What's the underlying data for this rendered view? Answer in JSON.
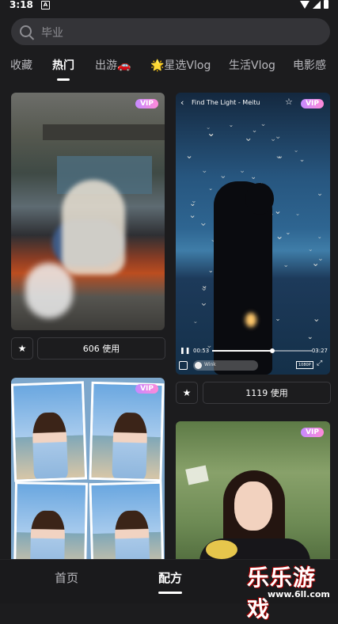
{
  "status_bar": {
    "time": "3:18",
    "notif_icon": "A"
  },
  "search": {
    "placeholder": "毕业"
  },
  "tabs": [
    {
      "label": "收藏"
    },
    {
      "label": "热门",
      "active": true
    },
    {
      "label": "出游🚗"
    },
    {
      "label": "🌟星选Vlog"
    },
    {
      "label": "生活Vlog"
    },
    {
      "label": "电影感"
    }
  ],
  "cards": [
    {
      "badge": "VIP",
      "uses": "606 使用"
    },
    {
      "badge": "VIP",
      "uses": "1119 使用",
      "player": {
        "title": "Find The Light - Meitu",
        "current": "00:53",
        "duration": "03:27",
        "progress": 0.6,
        "chip": "Wink",
        "resolution": "1080P"
      }
    },
    {
      "badge": "VIP"
    },
    {
      "badge": "VIP"
    }
  ],
  "bottom_nav": [
    {
      "label": "首页"
    },
    {
      "label": "配方",
      "active": true
    }
  ],
  "watermark": {
    "text": "乐乐游戏",
    "url": "www.6ll.com"
  },
  "icons": {
    "search": "search-icon",
    "star": "star-icon",
    "back": "back-icon",
    "pause": "pause-icon",
    "fullscreen": "fullscreen-icon"
  }
}
